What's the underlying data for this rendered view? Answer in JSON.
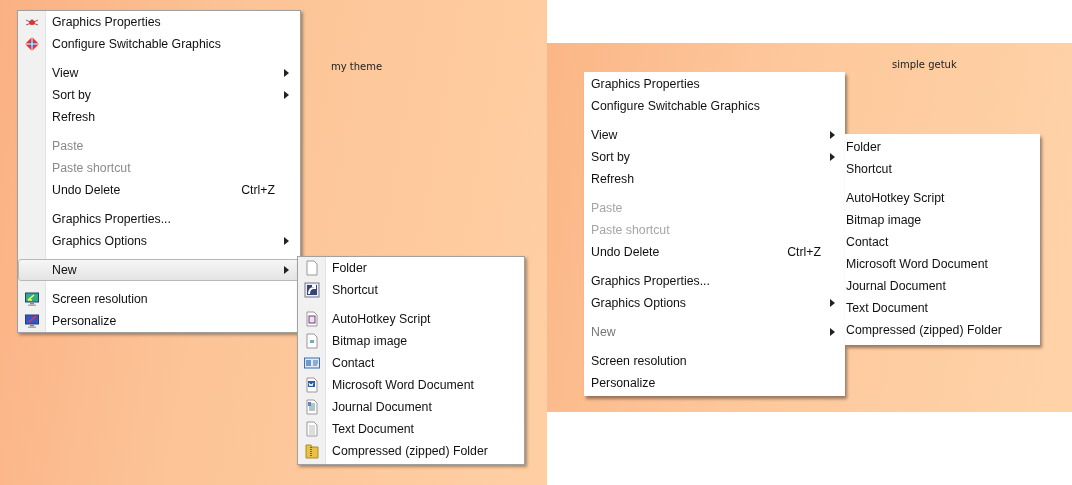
{
  "panels": [
    {
      "kind": "classic",
      "caption": "my theme",
      "menu": {
        "groups": [
          {
            "items": [
              {
                "label": "Graphics Properties",
                "disabled": false,
                "selected": false,
                "has_submenu": false
              },
              {
                "label": "Configure Switchable Graphics",
                "disabled": false,
                "selected": false,
                "has_submenu": false
              }
            ]
          },
          {
            "items": [
              {
                "label": "View",
                "disabled": false,
                "selected": false,
                "has_submenu": true
              },
              {
                "label": "Sort by",
                "disabled": false,
                "selected": false,
                "has_submenu": true
              },
              {
                "label": "Refresh",
                "disabled": false,
                "selected": false,
                "has_submenu": false
              }
            ]
          },
          {
            "items": [
              {
                "label": "Paste",
                "disabled": true,
                "selected": false,
                "has_submenu": false
              },
              {
                "label": "Paste shortcut",
                "disabled": true,
                "selected": false,
                "has_submenu": false
              },
              {
                "label": "Undo Delete",
                "shortcut": "Ctrl+Z",
                "disabled": false,
                "selected": false,
                "has_submenu": false
              }
            ]
          },
          {
            "items": [
              {
                "label": "Graphics Properties...",
                "disabled": false,
                "selected": false,
                "has_submenu": false
              },
              {
                "label": "Graphics Options",
                "disabled": false,
                "selected": false,
                "has_submenu": true
              }
            ]
          },
          {
            "items": [
              {
                "label": "New",
                "disabled": false,
                "selected": true,
                "has_submenu": true
              }
            ]
          },
          {
            "items": [
              {
                "label": "Screen resolution",
                "disabled": false,
                "selected": false,
                "has_submenu": false
              },
              {
                "label": "Personalize",
                "disabled": false,
                "selected": false,
                "has_submenu": false
              }
            ]
          }
        ]
      },
      "submenu": {
        "groups": [
          {
            "items": [
              {
                "label": "Folder"
              },
              {
                "label": "Shortcut"
              }
            ]
          },
          {
            "items": [
              {
                "label": "AutoHotkey Script"
              },
              {
                "label": "Bitmap image"
              },
              {
                "label": "Contact"
              },
              {
                "label": "Microsoft Word Document"
              },
              {
                "label": "Journal Document"
              },
              {
                "label": "Text Document"
              },
              {
                "label": "Compressed (zipped) Folder"
              }
            ]
          }
        ]
      }
    },
    {
      "kind": "simple",
      "caption": "simple getuk",
      "menu": {
        "groups": [
          {
            "items": [
              {
                "label": "Graphics Properties",
                "disabled": false,
                "selected": false,
                "has_submenu": false
              },
              {
                "label": "Configure Switchable Graphics",
                "disabled": false,
                "selected": false,
                "has_submenu": false
              }
            ]
          },
          {
            "items": [
              {
                "label": "View",
                "disabled": false,
                "selected": false,
                "has_submenu": true
              },
              {
                "label": "Sort by",
                "disabled": false,
                "selected": false,
                "has_submenu": true
              },
              {
                "label": "Refresh",
                "disabled": false,
                "selected": false,
                "has_submenu": false
              }
            ]
          },
          {
            "items": [
              {
                "label": "Paste",
                "disabled": true,
                "selected": false,
                "has_submenu": false
              },
              {
                "label": "Paste shortcut",
                "disabled": true,
                "selected": false,
                "has_submenu": false
              },
              {
                "label": "Undo Delete",
                "shortcut": "Ctrl+Z",
                "disabled": false,
                "selected": false,
                "has_submenu": false
              }
            ]
          },
          {
            "items": [
              {
                "label": "Graphics Properties...",
                "disabled": false,
                "selected": false,
                "has_submenu": false
              },
              {
                "label": "Graphics Options",
                "disabled": false,
                "selected": false,
                "has_submenu": true
              }
            ]
          },
          {
            "items": [
              {
                "label": "New",
                "disabled": false,
                "selected": true,
                "has_submenu": true
              }
            ]
          },
          {
            "items": [
              {
                "label": "Screen resolution",
                "disabled": false,
                "selected": false,
                "has_submenu": false
              },
              {
                "label": "Personalize",
                "disabled": false,
                "selected": false,
                "has_submenu": false
              }
            ]
          }
        ]
      },
      "submenu": {
        "groups": [
          {
            "items": [
              {
                "label": "Folder"
              },
              {
                "label": "Shortcut"
              }
            ]
          },
          {
            "items": [
              {
                "label": "AutoHotkey Script"
              },
              {
                "label": "Bitmap image"
              },
              {
                "label": "Contact"
              },
              {
                "label": "Microsoft Word Document"
              },
              {
                "label": "Journal Document"
              },
              {
                "label": "Text Document"
              },
              {
                "label": "Compressed (zipped) Folder"
              }
            ]
          }
        ]
      }
    }
  ]
}
